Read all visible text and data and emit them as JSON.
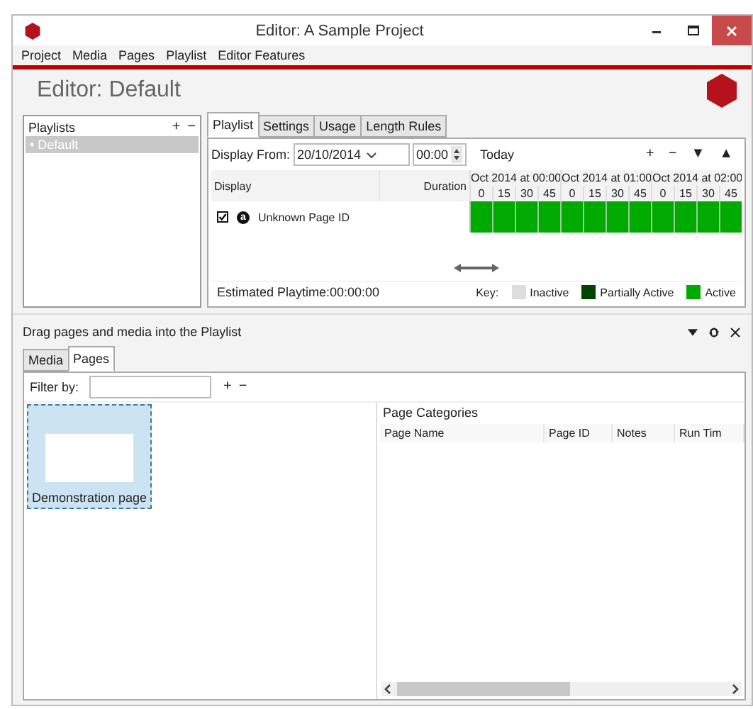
{
  "window": {
    "title": "Editor: A Sample Project"
  },
  "menu": [
    "Project",
    "Media",
    "Pages",
    "Playlist",
    "Editor Features"
  ],
  "header": {
    "title": "Editor: Default"
  },
  "playlists": {
    "title": "Playlists",
    "add": "+",
    "remove": "−",
    "items": [
      {
        "bullet": "•",
        "label": "Default",
        "selected": true
      }
    ]
  },
  "tabs": [
    {
      "label": "Playlist",
      "selected": true
    },
    {
      "label": "Settings",
      "selected": false
    },
    {
      "label": "Usage",
      "selected": false
    },
    {
      "label": "Length Rules",
      "selected": false
    }
  ],
  "display_from": {
    "label": "Display From:",
    "date": "20/10/2014",
    "time": "00:00",
    "today": "Today"
  },
  "zoom_controls": [
    "+",
    "−",
    "▼",
    "▲"
  ],
  "timeline": {
    "display_header": "Display",
    "duration_header": "Duration",
    "hours": [
      {
        "label": "Oct 2014 at 00:00",
        "minutes": [
          "0",
          "15",
          "30",
          "45"
        ]
      },
      {
        "label": "Oct 2014 at 01:00",
        "minutes": [
          "0",
          "15",
          "30",
          "45"
        ]
      },
      {
        "label": "Oct 2014 at 02:00",
        "minutes": [
          "0",
          "15",
          "30",
          "45"
        ]
      }
    ],
    "rows": [
      {
        "checked": true,
        "badge": "a",
        "name": "Unknown Page ID",
        "cells": [
          {
            "active": true
          },
          {
            "active": true
          },
          {
            "active": true
          },
          {
            "active": true
          },
          {
            "active": true
          },
          {
            "active": true
          },
          {
            "active": true
          },
          {
            "active": true
          },
          {
            "active": true
          },
          {
            "active": true
          },
          {
            "active": true
          },
          {
            "active": true
          }
        ]
      }
    ]
  },
  "estimated": "Estimated Playtime:00:00:00",
  "key": {
    "label": "Key:",
    "items": [
      {
        "label": "Inactive",
        "color": "#dddddd"
      },
      {
        "label": "Partially Active",
        "color": "#004400"
      },
      {
        "label": "Active",
        "color": "#00aa00"
      }
    ]
  },
  "lower": {
    "title": "Drag pages and media into the Playlist",
    "tabs": [
      {
        "label": "Media",
        "selected": false
      },
      {
        "label": "Pages",
        "selected": true
      }
    ],
    "filter": {
      "label": "Filter by:",
      "add": "+",
      "remove": "−"
    },
    "pages": [
      {
        "label": "Demonstration page",
        "selected": true
      }
    ],
    "categories": {
      "title": "Page Categories",
      "columns": [
        "Page Name",
        "Page ID",
        "Notes",
        "Run Tim"
      ]
    }
  }
}
